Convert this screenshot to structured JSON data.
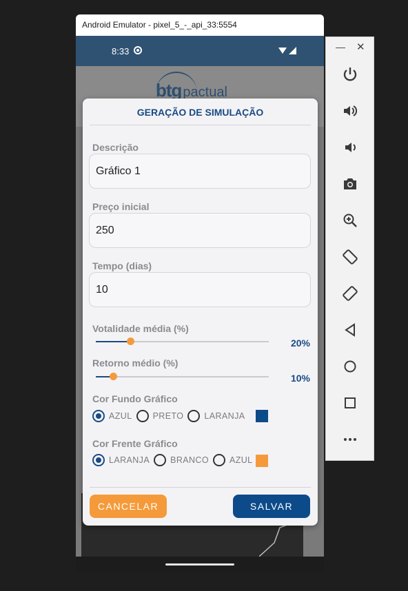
{
  "window": {
    "title": "Android Emulator - pixel_5_-_api_33:5554"
  },
  "statusbar": {
    "time": "8:33"
  },
  "app": {
    "logo_primary": "btg",
    "logo_secondary": "pactual"
  },
  "dialog": {
    "title": "GERAÇÃO DE SIMULAÇÃO",
    "fields": [
      {
        "label": "Descrição",
        "value": "Gráfico 1"
      },
      {
        "label": "Preço inicial",
        "value": "250"
      },
      {
        "label": "Tempo (dias)",
        "value": "10"
      }
    ],
    "sliders": [
      {
        "label": "Votalidade média (%)",
        "value_text": "20%",
        "fraction": 0.2
      },
      {
        "label": "Retorno médio (%)",
        "value_text": "10%",
        "fraction": 0.1
      }
    ],
    "background_color": {
      "label": "Cor Fundo Gráfico",
      "options": [
        "AZUL",
        "PRETO",
        "LARANJA"
      ],
      "selected": "AZUL",
      "swatch": "#0d4a8a"
    },
    "foreground_color": {
      "label": "Cor Frente Gráfico",
      "options": [
        "LARANJA",
        "BRANCO",
        "AZUL"
      ],
      "selected": "LARANJA",
      "swatch": "#f59a3a"
    },
    "cancel_label": "CANCELAR",
    "save_label": "SALVAR"
  },
  "side_panel": {
    "minimize_label": "—",
    "close_label": "✕",
    "icons": [
      "power-icon",
      "volume-up-icon",
      "volume-down-icon",
      "camera-icon",
      "zoom-in-icon",
      "rotate-left-icon",
      "rotate-right-icon",
      "back-icon",
      "home-icon",
      "overview-icon",
      "more-icon"
    ]
  },
  "colors": {
    "primary": "#1a4a82",
    "accent": "#f59a3a",
    "statusbar": "#2f5272"
  }
}
